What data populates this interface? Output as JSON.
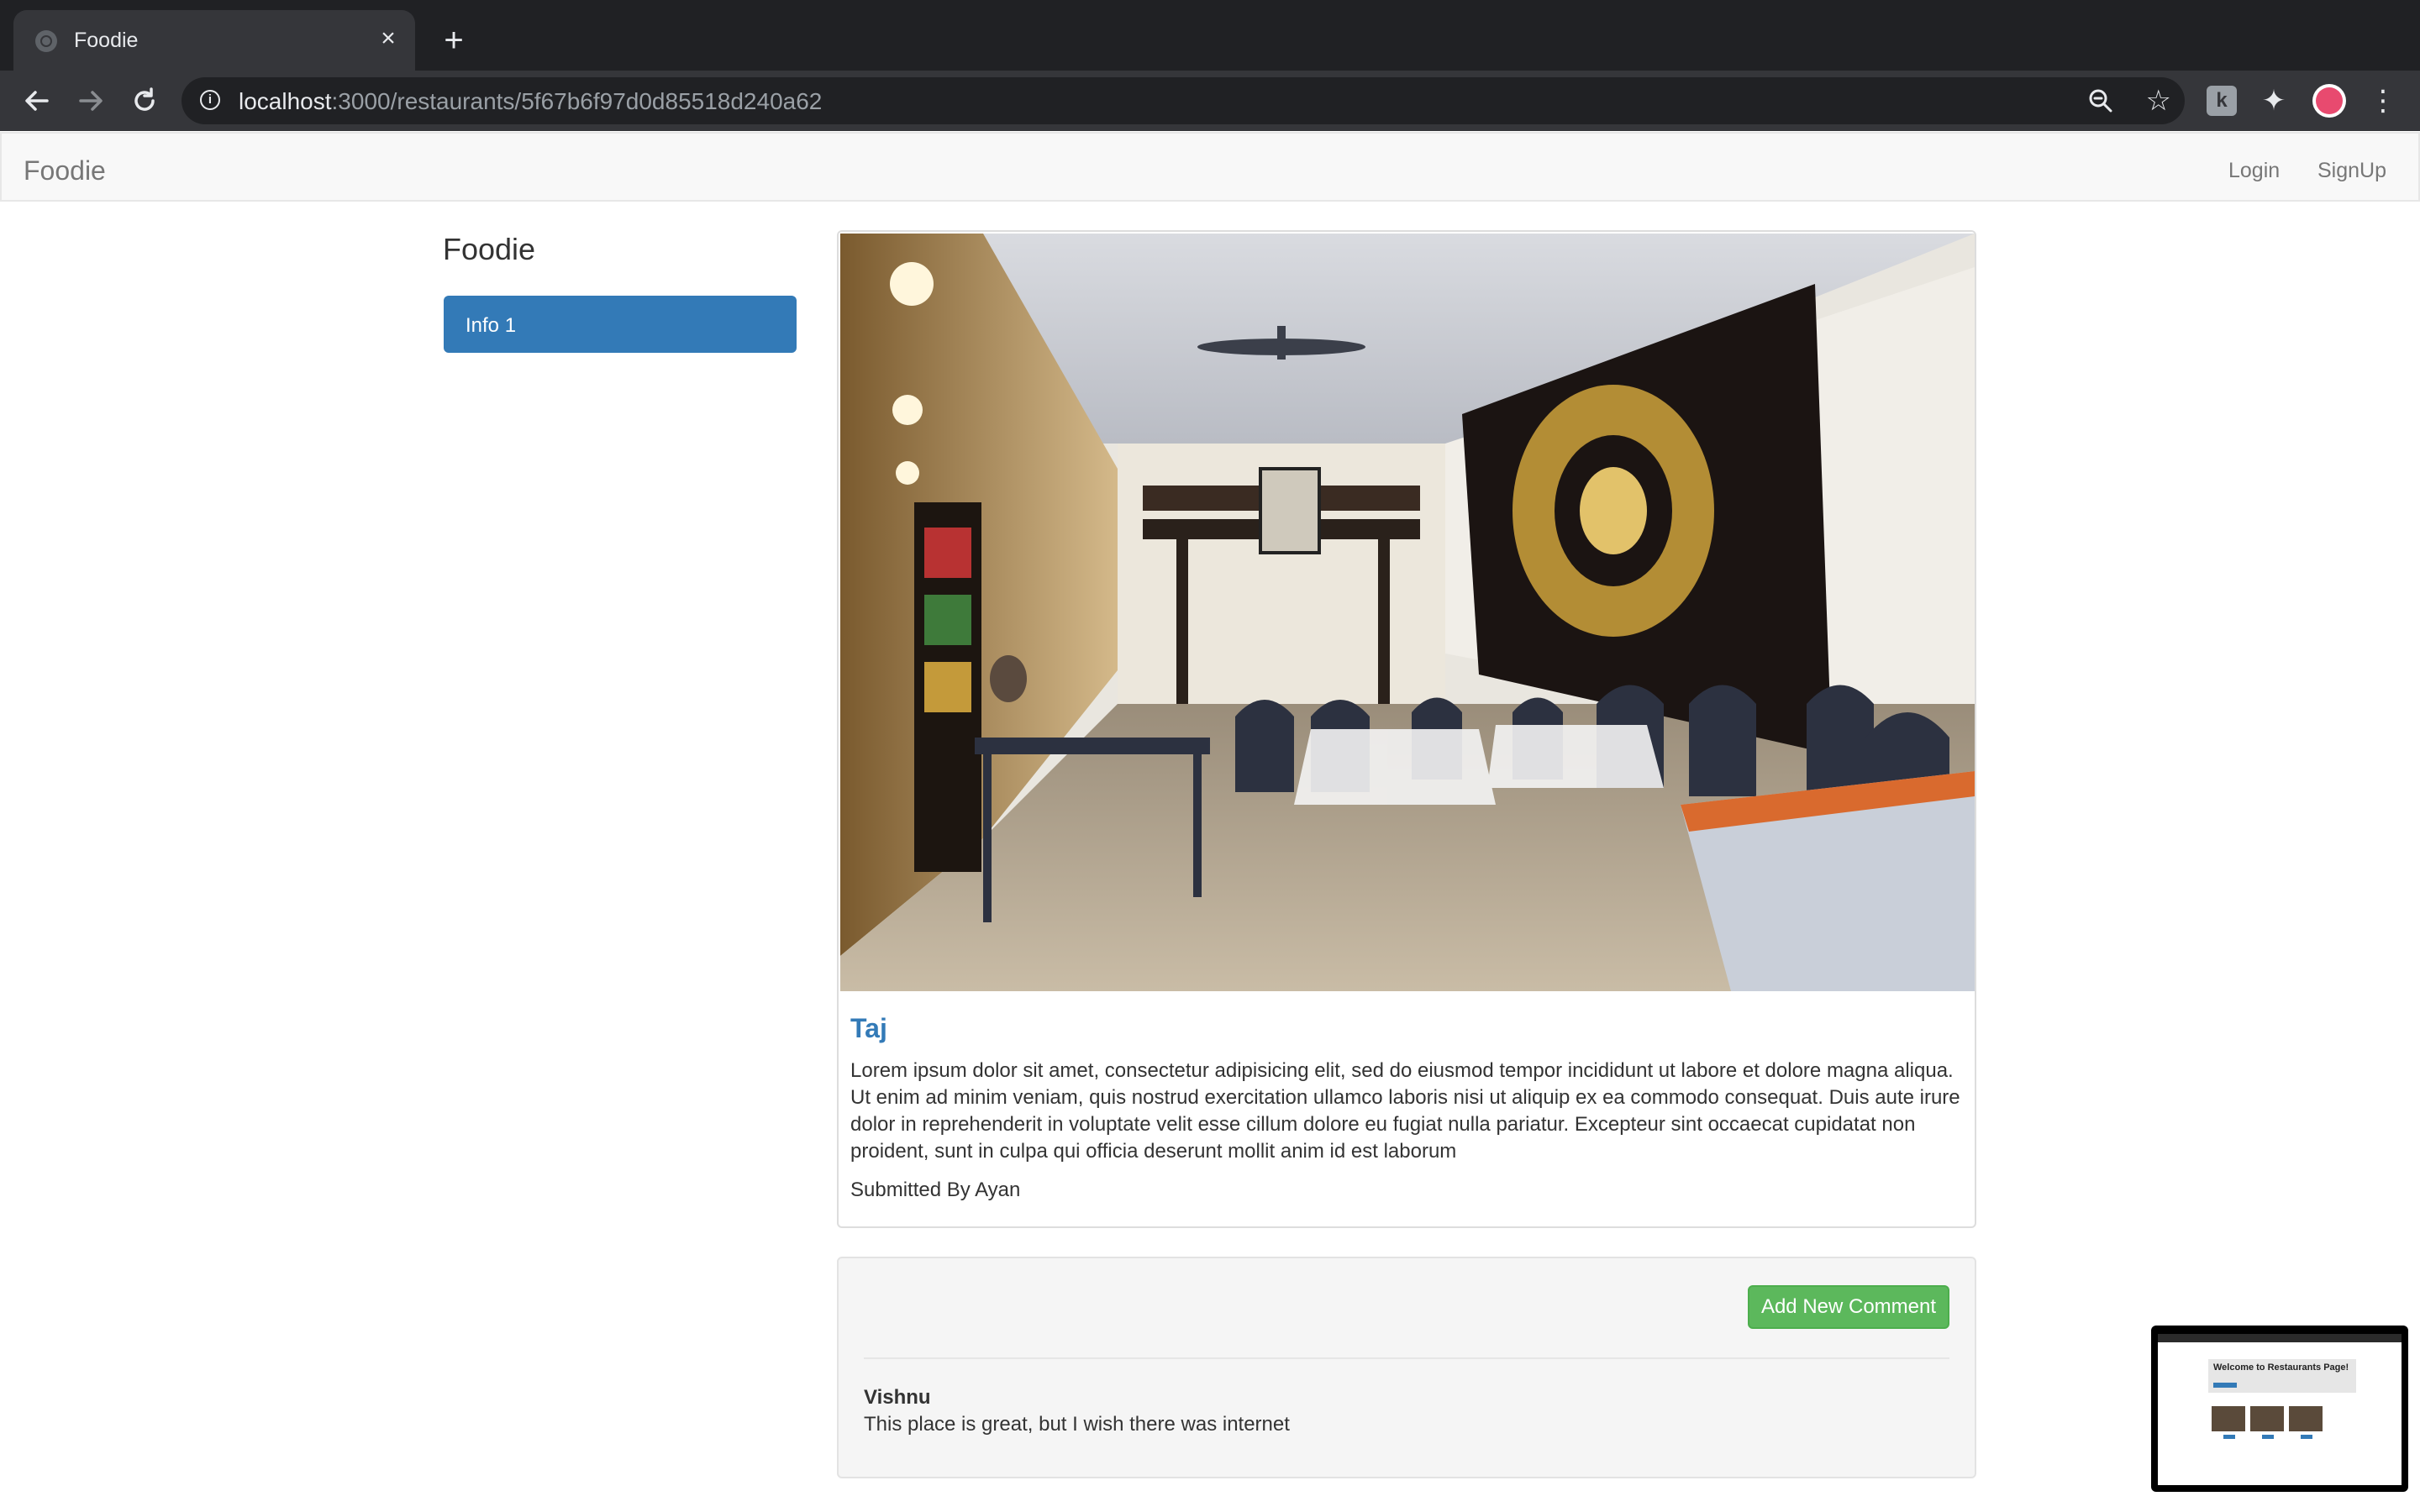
{
  "browser": {
    "tab_title": "Foodie",
    "url_host": "localhost",
    "url_path": ":3000/restaurants/5f67b6f97d0d85518d240a62"
  },
  "navbar": {
    "brand": "Foodie",
    "links": [
      "Login",
      "SignUp"
    ]
  },
  "sidebar": {
    "title": "Foodie",
    "items": [
      "Info 1"
    ]
  },
  "restaurant": {
    "name": "Taj",
    "description": "Lorem ipsum dolor sit amet, consectetur adipisicing elit, sed do eiusmod tempor incididunt ut labore et dolore magna aliqua. Ut enim ad minim veniam, quis nostrud exercitation ullamco laboris nisi ut aliquip ex ea commodo consequat. Duis aute irure dolor in reprehenderit in voluptate velit esse cillum dolore eu fugiat nulla pariatur. Excepteur sint occaecat cupidatat non proident, sunt in culpa qui officia deserunt mollit anim id est laborum",
    "submitted_by": "Submitted By Ayan"
  },
  "comments_section": {
    "add_button": "Add New Comment",
    "comments": [
      {
        "author": "Vishnu",
        "text": "This place is great, but I wish there was internet"
      }
    ]
  },
  "thumbnail": {
    "title": "Welcome to Restaurants Page!"
  },
  "colors": {
    "primary": "#337ab7",
    "success": "#5cb85c",
    "browser_dark": "#202124"
  }
}
